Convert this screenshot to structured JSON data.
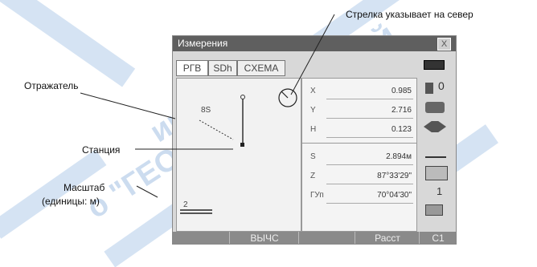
{
  "callouts": {
    "north": "Стрелка указывает на север",
    "reflector": "Отражатель",
    "station": "Станция",
    "scale_line1": "Масштаб",
    "scale_line2": "(единицы: м)"
  },
  "window": {
    "title": "Измерения",
    "close": "X"
  },
  "tabs": [
    "PГВ",
    "SDh",
    "CXEMA"
  ],
  "plot": {
    "point_label": "8S",
    "scale_value": "2"
  },
  "table": {
    "rows": [
      {
        "label": "X",
        "value": "0.985"
      },
      {
        "label": "Y",
        "value": "2.716"
      },
      {
        "label": "H",
        "value": "0.123"
      },
      {
        "label": "S",
        "value": "2.894м"
      },
      {
        "label": "Z",
        "value": "87°33'29\""
      },
      {
        "label": "ГУп",
        "value": "70°04'30\""
      }
    ]
  },
  "side": {
    "p0": "0",
    "p1": "1"
  },
  "softkeys": [
    "",
    "ВЫЧС",
    "",
    "Расст",
    "C1"
  ],
  "colors": {
    "watermark": "#3f7fc8",
    "titlebar": "#5f5f5f",
    "softkey_bar": "#8a8a8a"
  }
}
